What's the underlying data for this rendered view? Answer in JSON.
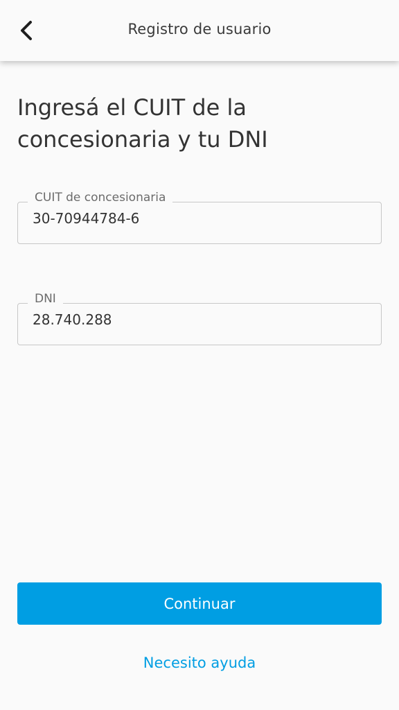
{
  "header": {
    "title": "Registro de usuario",
    "back_icon": "chevron-left-icon"
  },
  "main": {
    "heading": "Ingresá el CUIT de la concesionaria y tu DNI",
    "fields": {
      "cuit": {
        "label": "CUIT de concesionaria",
        "value": "30-70944784-6"
      },
      "dni": {
        "label": "DNI",
        "value": "28.740.288"
      }
    }
  },
  "actions": {
    "continue_label": "Continuar",
    "help_label": "Necesito ayuda"
  },
  "colors": {
    "accent": "#009ee3",
    "text": "#333333",
    "border": "#c7c7c7",
    "background": "#fafafa"
  }
}
